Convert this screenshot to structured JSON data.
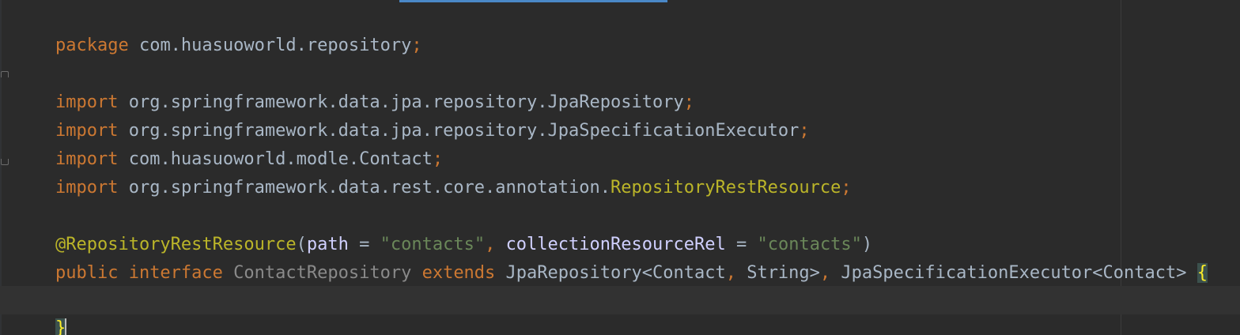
{
  "editor": {
    "line1": {
      "kw": "package",
      "name": " com.huasuoworld.repository",
      "semi": ";"
    },
    "imports": [
      {
        "kw": "import",
        "path": " org.springframework.data.jpa.repository.JpaRepository",
        "semi": ";"
      },
      {
        "kw": "import",
        "path": " org.springframework.data.jpa.repository.JpaSpecificationExecutor",
        "semi": ";"
      },
      {
        "kw": "import",
        "path": " com.huasuoworld.modle.Contact",
        "semi": ";"
      },
      {
        "kw": "import",
        "path_prefix": " org.springframework.data.rest.core.annotation.",
        "path_ann": "RepositoryRestResource",
        "semi": ";"
      }
    ],
    "annotation": {
      "name": "@RepositoryRestResource",
      "open": "(",
      "p1": "path",
      "eq1": " = ",
      "v1": "\"contacts\"",
      "comma": ", ",
      "p2": "collectionResourceRel",
      "eq2": " = ",
      "v2": "\"contacts\"",
      "close": ")"
    },
    "decl": {
      "kw1": "public interface",
      "name": " ContactRepository ",
      "kw2": "extends",
      "t1": " JpaRepository<Contact",
      "c1": ",",
      "t2": " String>",
      "c2": ",",
      "t3": " JpaSpecificationExecutor<Contact> ",
      "brace": "{"
    },
    "closing": "}"
  }
}
